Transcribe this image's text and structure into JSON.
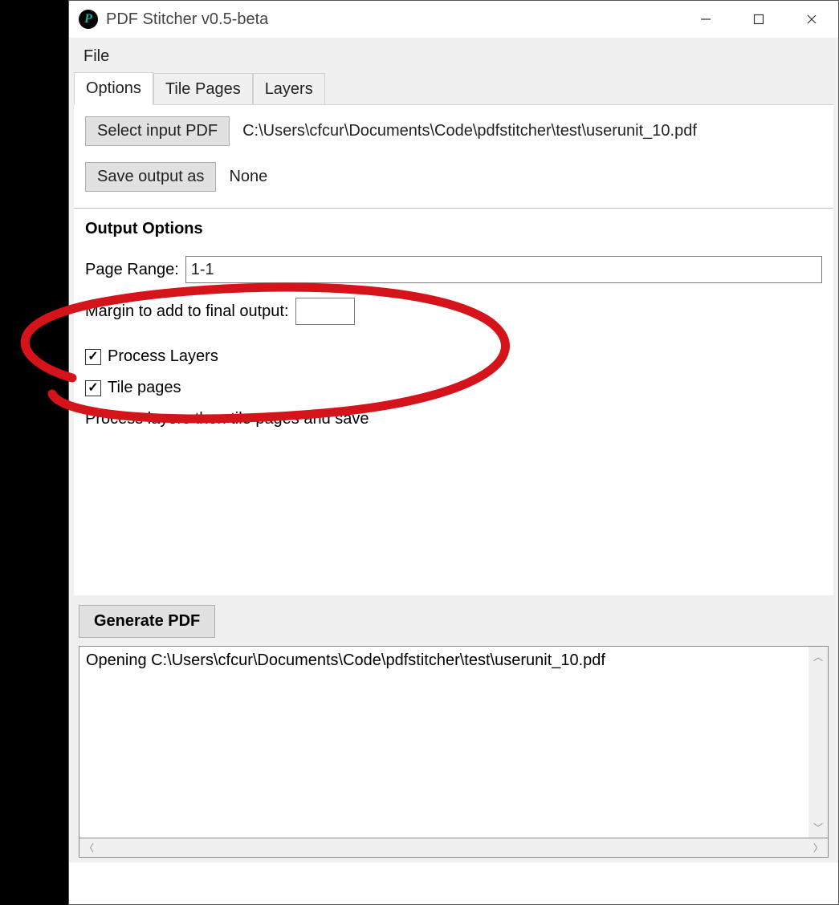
{
  "window": {
    "title": "PDF Stitcher v0.5-beta",
    "app_icon_letter": "P"
  },
  "menubar": {
    "file": "File"
  },
  "tabs": {
    "options": "Options",
    "tile_pages": "Tile Pages",
    "layers": "Layers"
  },
  "options_panel": {
    "select_input_btn": "Select input PDF",
    "input_path": "C:\\Users\\cfcur\\Documents\\Code\\pdfstitcher\\test\\userunit_10.pdf",
    "save_output_btn": "Save output as",
    "output_path": "None",
    "output_options_title": "Output Options",
    "page_range_label": "Page Range:",
    "page_range_value": "1-1",
    "margin_label": "Margin to add to final output:",
    "margin_value": "",
    "process_layers_label": "Process Layers",
    "process_layers_checked": true,
    "tile_pages_label": "Tile pages",
    "tile_pages_checked": true,
    "note": "Process layers then tile pages and save"
  },
  "generate_btn": "Generate PDF",
  "log": {
    "line1": "Opening C:\\Users\\cfcur\\Documents\\Code\\pdfstitcher\\test\\userunit_10.pdf"
  }
}
